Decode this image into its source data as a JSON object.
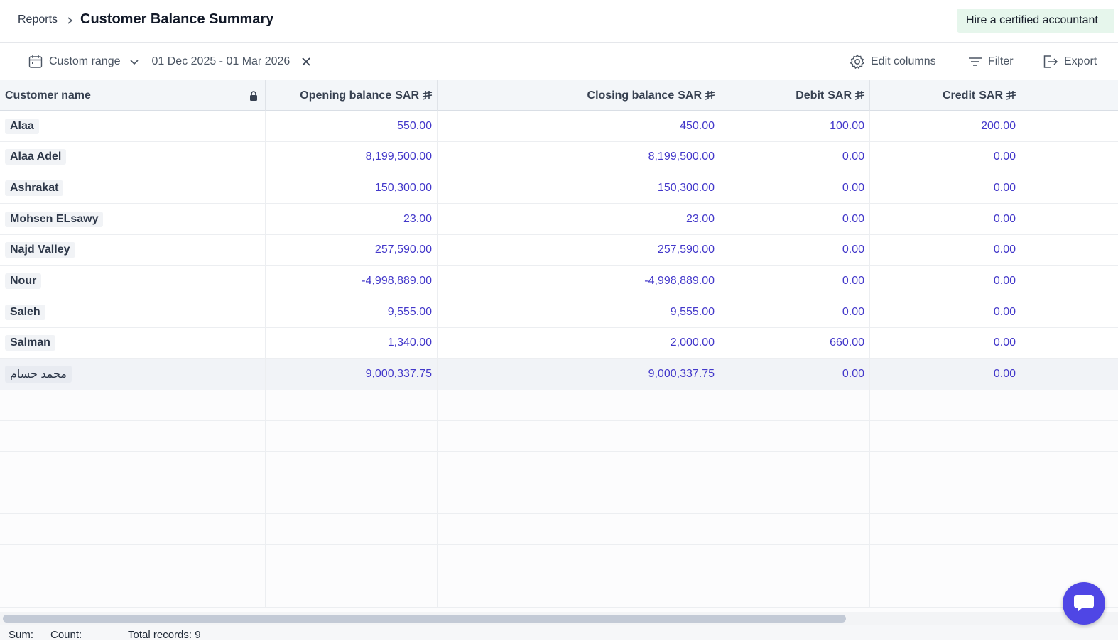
{
  "breadcrumb": {
    "parent": "Reports",
    "current": "Customer Balance Summary"
  },
  "hire_button": "Hire a certified accountant",
  "toolbar": {
    "range_label": "Custom range",
    "date_range": "01 Dec 2025 - 01 Mar 2026",
    "edit_columns": "Edit columns",
    "filter": "Filter",
    "export": "Export"
  },
  "columns": {
    "name": "Customer name",
    "opening": "Opening balance",
    "closing": "Closing balance",
    "debit": "Debit",
    "credit": "Credit",
    "currency": "SAR"
  },
  "rows": [
    {
      "name": "Alaa",
      "opening": "550.00",
      "closing": "450.00",
      "debit": "100.00",
      "credit": "200.00"
    },
    {
      "name": "Alaa Adel",
      "opening": "8,199,500.00",
      "closing": "8,199,500.00",
      "debit": "0.00",
      "credit": "0.00"
    },
    {
      "name": "Ashrakat",
      "opening": "150,300.00",
      "closing": "150,300.00",
      "debit": "0.00",
      "credit": "0.00"
    },
    {
      "name": "Mohsen ELsawy",
      "opening": "23.00",
      "closing": "23.00",
      "debit": "0.00",
      "credit": "0.00"
    },
    {
      "name": "Najd Valley",
      "opening": "257,590.00",
      "closing": "257,590.00",
      "debit": "0.00",
      "credit": "0.00"
    },
    {
      "name": "Nour",
      "opening": "-4,998,889.00",
      "closing": "-4,998,889.00",
      "debit": "0.00",
      "credit": "0.00"
    },
    {
      "name": "Saleh",
      "opening": "9,555.00",
      "closing": "9,555.00",
      "debit": "0.00",
      "credit": "0.00"
    },
    {
      "name": "Salman",
      "opening": "1,340.00",
      "closing": "2,000.00",
      "debit": "660.00",
      "credit": "0.00"
    },
    {
      "name": "محمد حسام",
      "opening": "9,000,337.75",
      "closing": "9,000,337.75",
      "debit": "0.00",
      "credit": "0.00"
    }
  ],
  "footer": {
    "sum": "Sum:",
    "count": "Count:",
    "total": "Total records: 9"
  }
}
